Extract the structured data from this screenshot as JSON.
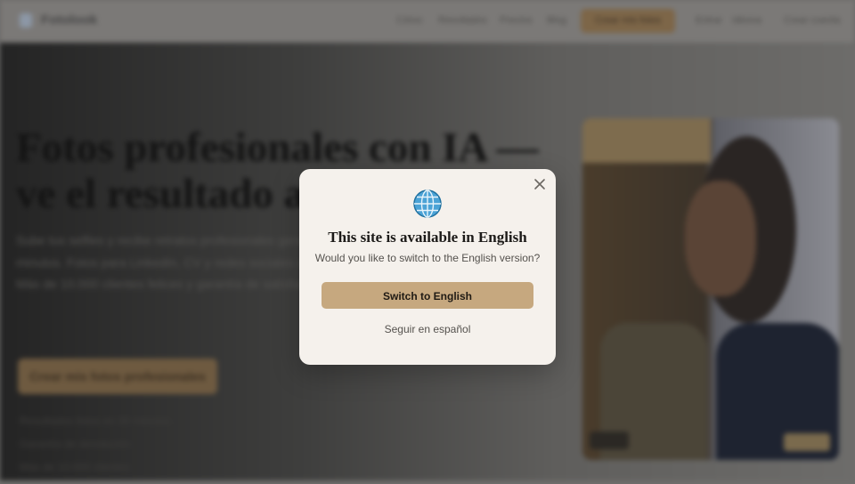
{
  "background": {
    "brand": {
      "name": "Fotolook"
    },
    "nav": {
      "items": [
        "Cómo",
        "Resultados",
        "Precios",
        "Blog"
      ],
      "cta": "Crear mis fotos",
      "extra": [
        "Entrar",
        "Idioma",
        "Crear cuenta"
      ]
    },
    "hero": {
      "title_line1": "Fotos profesionales con IA —",
      "title_line2": "ve el resultado antes de pagar",
      "paragraph": "Sube tus selfies y recibe retratos profesionales generados con inteligencia artificial en minutos. Fotos para LinkedIn, CV y redes sociales con calidad de estudio, sin salir de casa. Más de 10.000 clientes felices y garantía de satisfacción total.",
      "cta": "Crear mis fotos profesionales",
      "bullets": [
        "Resultados listos en 30 minutos",
        "Garantía de devolución",
        "Más de 10.000 clientes"
      ]
    }
  },
  "modal": {
    "icon": "globe-icon",
    "title": "This site is available in English",
    "subtitle": "Would you like to switch to the English version?",
    "primary_button": "Switch to English",
    "secondary_link": "Seguir en español",
    "close_icon": "close-icon"
  },
  "colors": {
    "accent": "#c6a87f",
    "modal_bg": "#f5f1ec",
    "overlay": "#6f6e6c"
  }
}
